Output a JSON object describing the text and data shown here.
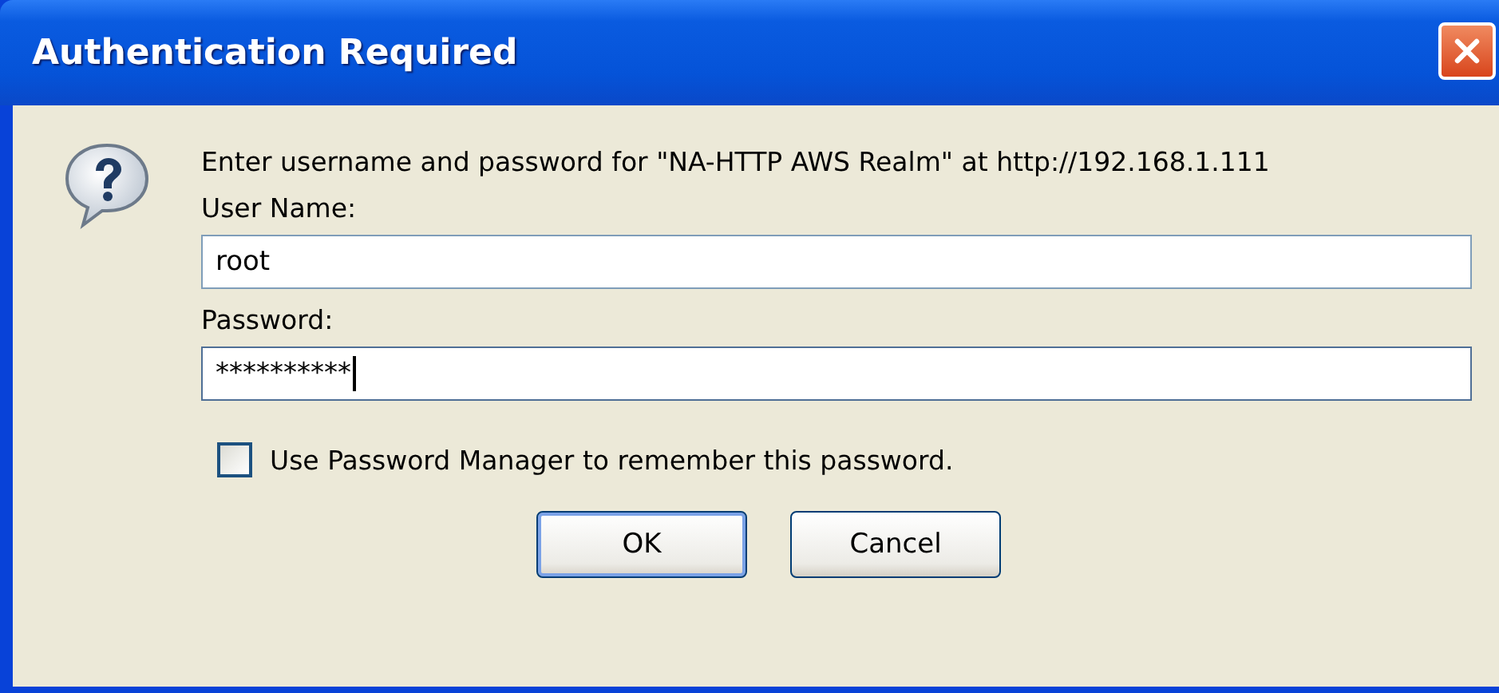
{
  "window": {
    "title": "Authentication Required"
  },
  "message": "Enter username and password for \"NA-HTTP AWS Realm\" at http://192.168.1.111",
  "fields": [
    {
      "label": "User Name:",
      "value": "root",
      "focused": false
    },
    {
      "label": "Password:",
      "value": "**********",
      "focused": true
    }
  ],
  "checkbox": {
    "label": "Use Password Manager to remember this password.",
    "checked": false
  },
  "buttons": [
    {
      "label": "OK",
      "default": true
    },
    {
      "label": "Cancel",
      "default": false
    }
  ]
}
